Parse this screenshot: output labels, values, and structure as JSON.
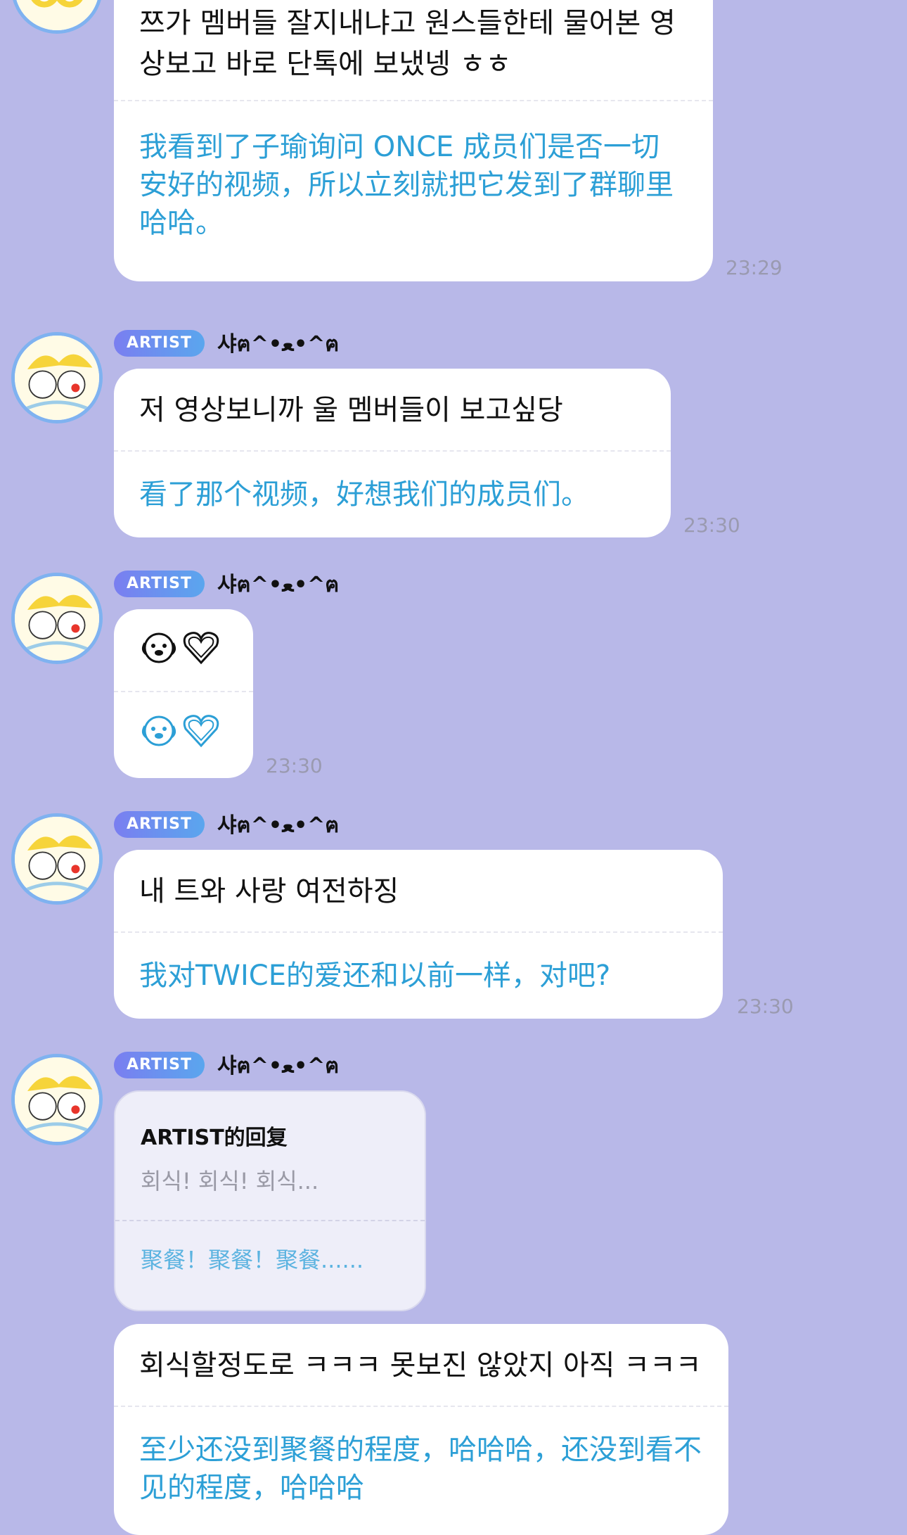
{
  "messages": [
    {
      "original": "쯔가 멤버들 잘지내냐고 원스들한테 물어본 영상보고 바로 단톡에 보냈넹 ㅎㅎ",
      "translation": "我看到了子瑜询问 ONCE 成员们是否一切安好的视频，所以立刻就把它发到了群聊里哈哈。",
      "time": "23:29"
    },
    {
      "badge": "ARTIST",
      "sender": "샤ฅ^•ﻌ•^ฅ",
      "original": "저 영상보니까 울 멤버들이 보고싶당",
      "translation": "看了那个视频，好想我们的成员们。",
      "time": "23:30"
    },
    {
      "badge": "ARTIST",
      "sender": "샤ฅ^•ﻌ•^ฅ",
      "original": "🐶♡",
      "translation": "🐶♡",
      "time": "23:30"
    },
    {
      "badge": "ARTIST",
      "sender": "샤ฅ^•ﻌ•^ฅ",
      "original": "내 트와 사랑 여전하징",
      "translation": "我对TWICE的爱还和以前一样，对吧?",
      "time": "23:30"
    },
    {
      "badge": "ARTIST",
      "sender": "샤ฅ^•ﻌ•^ฅ",
      "reply_title": "ARTIST的回复",
      "reply_original": "회식! 회식! 회식...",
      "reply_translation": "聚餐！聚餐！聚餐......",
      "original": "회식할정도로 ㅋㅋㅋ 못보진 않았지 아직 ㅋㅋㅋ",
      "translation": "至少还没到聚餐的程度，哈哈哈，还没到看不见的程度，哈哈哈"
    }
  ],
  "colors": {
    "background": "#b8b8e8",
    "bubble": "#ffffff",
    "translation_text": "#2c9fd6",
    "timestamp": "#9a9ab0",
    "badge_start": "#7a7ef0",
    "badge_end": "#5aa6ee"
  },
  "icons": [
    "avatar-cartoon-icon",
    "puppy-face-icon",
    "heart-outline-icon"
  ]
}
